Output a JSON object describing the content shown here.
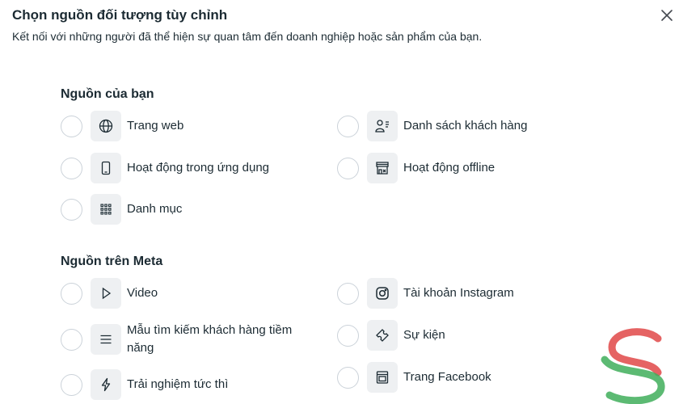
{
  "header": {
    "title": "Chọn nguồn đối tượng tùy chỉnh",
    "subtitle": "Kết nối với những người đã thể hiện sự quan tâm đến doanh nghiệp hoặc sản phẩm của bạn.",
    "close_icon": "close-icon"
  },
  "sections": [
    {
      "title": "Nguồn của bạn",
      "options": [
        {
          "label": "Trang web",
          "icon": "globe-icon"
        },
        {
          "label": "Danh sách khách hàng",
          "icon": "customer-list-icon"
        },
        {
          "label": "Hoạt động trong ứng dụng",
          "icon": "mobile-phone-icon"
        },
        {
          "label": "Hoạt động offline",
          "icon": "store-icon"
        },
        {
          "label": "Danh mục",
          "icon": "grid-icon"
        }
      ]
    },
    {
      "title": "Nguồn trên Meta",
      "options": [
        {
          "label": "Video",
          "icon": "play-icon"
        },
        {
          "label": "Tài khoản Instagram",
          "icon": "instagram-icon"
        },
        {
          "label": "Mẫu tìm kiếm khách hàng tiềm năng",
          "icon": "list-icon"
        },
        {
          "label": "Sự kiện",
          "icon": "ticket-icon"
        },
        {
          "label": "Trải nghiệm tức thì",
          "icon": "lightning-icon"
        },
        {
          "label": "Trang Facebook",
          "icon": "facebook-page-icon"
        }
      ]
    }
  ],
  "colors": {
    "text": "#1c2b33",
    "icon_background": "#eef0f2",
    "radio_border": "#cbd2d9",
    "watermark_red": "#e04848",
    "watermark_green": "#3fae5a"
  }
}
